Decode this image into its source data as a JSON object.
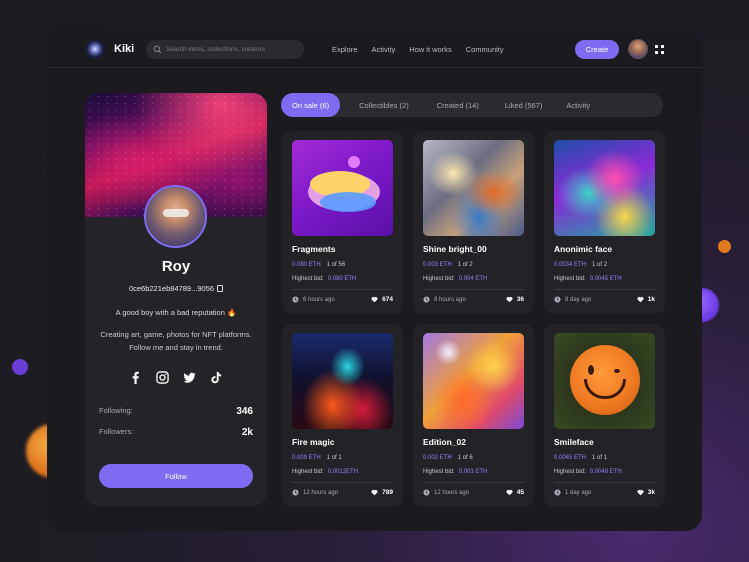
{
  "app": {
    "name": "Kiki"
  },
  "search": {
    "placeholder": "Search items, collections, creators"
  },
  "nav": [
    "Explore",
    "Activity",
    "How it works",
    "Community"
  ],
  "header": {
    "create_label": "Create"
  },
  "profile": {
    "name": "Roy",
    "address": "0ce6b221eb84789...9056",
    "bio_line1": "A good boy with a bad reputation 🔥",
    "bio_line2": "Creating art, game, photos for NFT platforms. Follow me and stay in trend.",
    "following_label": "Following:",
    "following_value": "346",
    "followers_label": "Followers:",
    "followers_value": "2k",
    "follow_label": "Follow",
    "socials": [
      "facebook-icon",
      "instagram-icon",
      "twitter-icon",
      "tiktok-icon"
    ]
  },
  "tabs": [
    {
      "label": "On sale (6)",
      "active": true
    },
    {
      "label": "Collectibles (2)",
      "active": false
    },
    {
      "label": "Created (14)",
      "active": false
    },
    {
      "label": "Liked (567)",
      "active": false
    },
    {
      "label": "Activity",
      "active": false
    }
  ],
  "cards": [
    {
      "title": "Fragments",
      "price": "0.080 ETH",
      "edition": "1 of 56",
      "bid_label": "Highest bid:",
      "bid": "0.080 ETH",
      "time": "6 hours ago",
      "likes": "674"
    },
    {
      "title": "Shine bright_00",
      "price": "0.003 ETH",
      "edition": "1 of 2",
      "bid_label": "Highest bid:",
      "bid": "0.004 ETH",
      "time": "8 hours ago",
      "likes": "36"
    },
    {
      "title": "Anonimic face",
      "price": "0.0034 ETH",
      "edition": "1 of 2",
      "bid_label": "Highest bid:",
      "bid": "0.0045 ETH",
      "time": "8 day ago",
      "likes": "1k"
    },
    {
      "title": "Fire magic",
      "price": "0.009 ETH",
      "edition": "1 of 1",
      "bid_label": "Highest bid:",
      "bid": "0.0012ETH",
      "time": "12 hours ago",
      "likes": "789"
    },
    {
      "title": "Edition_02",
      "price": "0.002 ETH",
      "edition": "1 of 6",
      "bid_label": "Highest bid:",
      "bid": "0.003 ETH",
      "time": "12 hours ago",
      "likes": "45"
    },
    {
      "title": "Smileface",
      "price": "0.0045 ETH",
      "edition": "1 of 1",
      "bid_label": "Highest bid:",
      "bid": "0.0048 ETH",
      "time": "1 day ago",
      "likes": "3k"
    }
  ],
  "colors": {
    "accent": "#7b6cf2",
    "price": "#8f83ff",
    "background": "#1b1b1f",
    "card": "#232327"
  }
}
